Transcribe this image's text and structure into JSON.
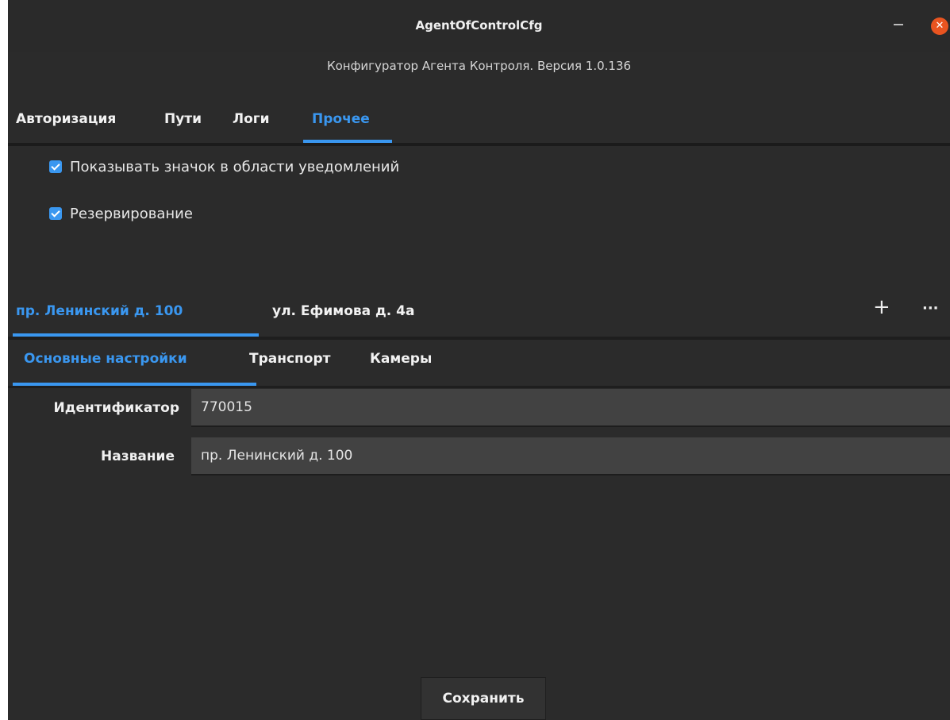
{
  "window": {
    "title": "AgentOfControlCfg",
    "subtitle": "Конфигуратор Агента Контроля. Версия 1.0.136",
    "minimize_glyph": "–",
    "close_glyph": "✕"
  },
  "tabs": [
    {
      "label": "Авторизация",
      "active": false
    },
    {
      "label": "Пути",
      "active": false
    },
    {
      "label": "Логи",
      "active": false
    },
    {
      "label": "Прочее",
      "active": true
    }
  ],
  "options": [
    {
      "label": "Показывать значок в области уведомлений",
      "checked": true
    },
    {
      "label": "Резервирование",
      "checked": true
    }
  ],
  "sites": {
    "tabs": [
      {
        "label": "пр. Ленинский д. 100",
        "active": true
      },
      {
        "label": "ул. Ефимова д. 4а",
        "active": false
      }
    ],
    "add_glyph": "+",
    "more_glyph": "···"
  },
  "subtabs": [
    {
      "label": "Основные настройки",
      "active": true
    },
    {
      "label": "Транспорт",
      "active": false
    },
    {
      "label": "Камеры",
      "active": false
    }
  ],
  "fields": [
    {
      "label": "Идентификатор",
      "value": "770015"
    },
    {
      "label": "Название",
      "value": "пр. Ленинский д. 100"
    }
  ],
  "save_label": "Сохранить",
  "colors": {
    "accent": "#3a97f0",
    "background": "#2b2b2b",
    "close": "#e95420"
  }
}
